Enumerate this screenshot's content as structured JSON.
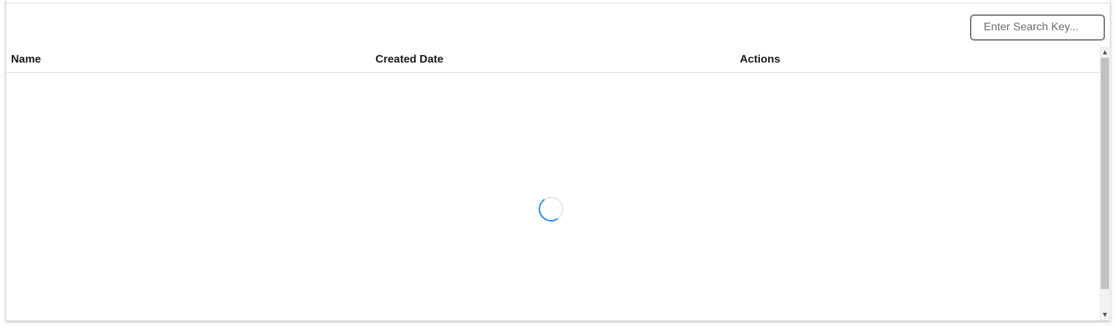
{
  "search": {
    "placeholder": "Enter Search Key...",
    "value": ""
  },
  "table": {
    "columns": [
      "Name",
      "Created Date",
      "Actions"
    ],
    "rows": []
  },
  "icons": {
    "spinner": "loading-spinner-icon",
    "scroll_up": "scroll-up-arrow-icon",
    "scroll_down": "scroll-down-arrow-icon"
  },
  "colors": {
    "spinner_accent": "#1e88e5",
    "spinner_track": "#e6e6e6",
    "border": "#777777"
  },
  "glyphs": {
    "up": "▲",
    "down": "▼"
  }
}
